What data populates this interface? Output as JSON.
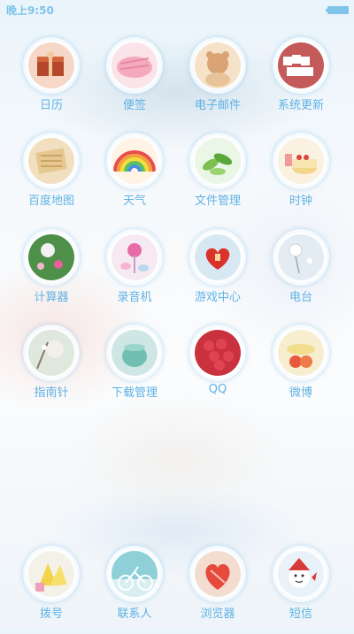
{
  "status_bar": {
    "time": "晚上9:50"
  },
  "apps": [
    {
      "label": "日历",
      "icon": "gift-box-icon"
    },
    {
      "label": "便签",
      "icon": "pink-notes-icon"
    },
    {
      "label": "电子邮件",
      "icon": "teddy-bear-icon"
    },
    {
      "label": "系统更新",
      "icon": "love-blocks-icon"
    },
    {
      "label": "百度地图",
      "icon": "letter-tiles-icon"
    },
    {
      "label": "天气",
      "icon": "rainbow-icon"
    },
    {
      "label": "文件管理",
      "icon": "green-leaves-icon"
    },
    {
      "label": "时钟",
      "icon": "cake-icon"
    },
    {
      "label": "计算器",
      "icon": "flowers-icon"
    },
    {
      "label": "录音机",
      "icon": "candy-icon"
    },
    {
      "label": "游戏中心",
      "icon": "red-heart-icon"
    },
    {
      "label": "电台",
      "icon": "dandelion-icon"
    },
    {
      "label": "指南针",
      "icon": "blossom-icon"
    },
    {
      "label": "下载管理",
      "icon": "teal-cup-icon"
    },
    {
      "label": "QQ",
      "icon": "raspberries-icon"
    },
    {
      "label": "微博",
      "icon": "fruit-bowl-icon"
    }
  ],
  "dock": [
    {
      "label": "拨号",
      "icon": "yellow-flowers-icon"
    },
    {
      "label": "联系人",
      "icon": "bicycle-icon"
    },
    {
      "label": "浏览器",
      "icon": "heart-cup-icon"
    },
    {
      "label": "短信",
      "icon": "snowman-icon"
    }
  ]
}
